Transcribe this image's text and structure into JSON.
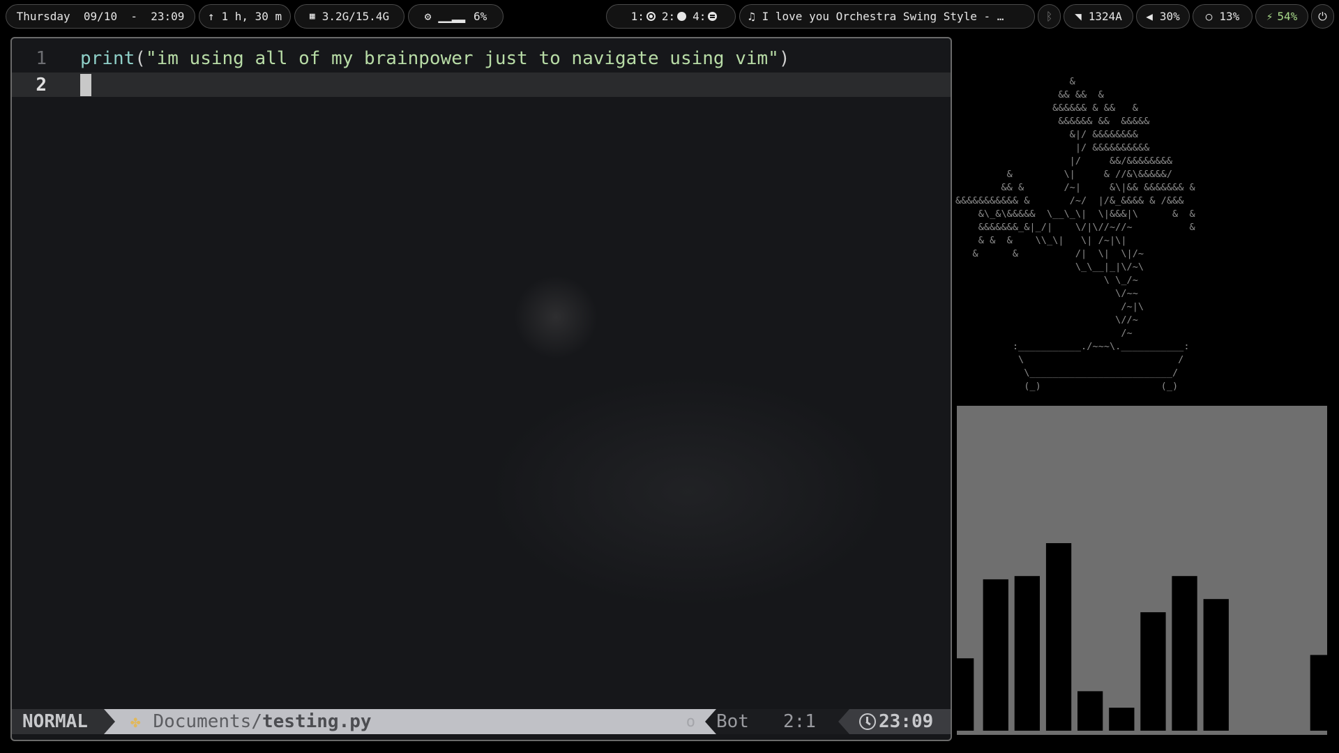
{
  "topbar": {
    "datetime": "Thursday  09/10  -  23:09",
    "uptime": "1 h, 30 m",
    "memory": "3.2G/15.4G",
    "cpu_graph": "▁▁▂▂",
    "cpu_percent": "6%",
    "workspaces": [
      {
        "label": "1:",
        "icon": "record-icon"
      },
      {
        "label": "2:",
        "icon": "moon-icon"
      },
      {
        "label": "4:",
        "icon": "spotify-icon"
      }
    ],
    "now_playing": "I love you Orchestra Swing Style - …",
    "network": "1324A",
    "volume": "30%",
    "brightness": "13%",
    "battery": "54%",
    "colors": {
      "battery": "#a8d98a",
      "bar_bg": "#131313",
      "bar_border": "#4a4a4a"
    }
  },
  "editor": {
    "lines": [
      {
        "number": "1",
        "code": {
          "fn": "print",
          "open": "(",
          "string": "\"im using all of my brainpower just to navigate using vim\"",
          "close": ")"
        }
      },
      {
        "number": "2",
        "code": {}
      }
    ],
    "status": {
      "mode": "NORMAL",
      "dir": "Documents/",
      "file": "testing.py",
      "indicator": "o",
      "scroll": "Bot",
      "position": "2:1",
      "clock": "23:09"
    }
  },
  "bonsai_art": "                    &\n                  && &&  &\n                 &&&&&& & &&   &\n                  &&&&&& &&  &&&&&\n                    &|/ &&&&&&&&\n                     |/ &&&&&&&&&&\n                    |/     &&/&&&&&&&&\n         &         \\|     & //&\\&&&&&/\n        && &       /~|     &\\|&& &&&&&&& &\n&&&&&&&&&&& &       /~/  |/&_&&&& & /&&&\n    &\\_&\\&&&&&  \\__\\_\\|  \\|&&&|\\      &  &\n    &&&&&&&_&|_/|    \\/|\\//~//~          &\n    & &  &    \\\\_\\|   \\| /~|\\|\n   &      &          /|  \\|  \\|/~\n                     \\_\\__|_|\\/~\\\n                          \\ \\_/~\n                            \\/~~\n                             /~|\\\n                            \\//~\n                             /~\n          :___________./~~~\\.___________:\n           \\                           /\n            \\_________________________/\n            (_)                     (_)",
  "visualizer": {
    "levels": [
      0.22,
      0.46,
      0.47,
      0.57,
      0.12,
      0.07,
      0.36,
      0.47,
      0.4,
      0.23
    ],
    "colors": {
      "background": "#6f6f6f",
      "bar": "#000000"
    }
  }
}
